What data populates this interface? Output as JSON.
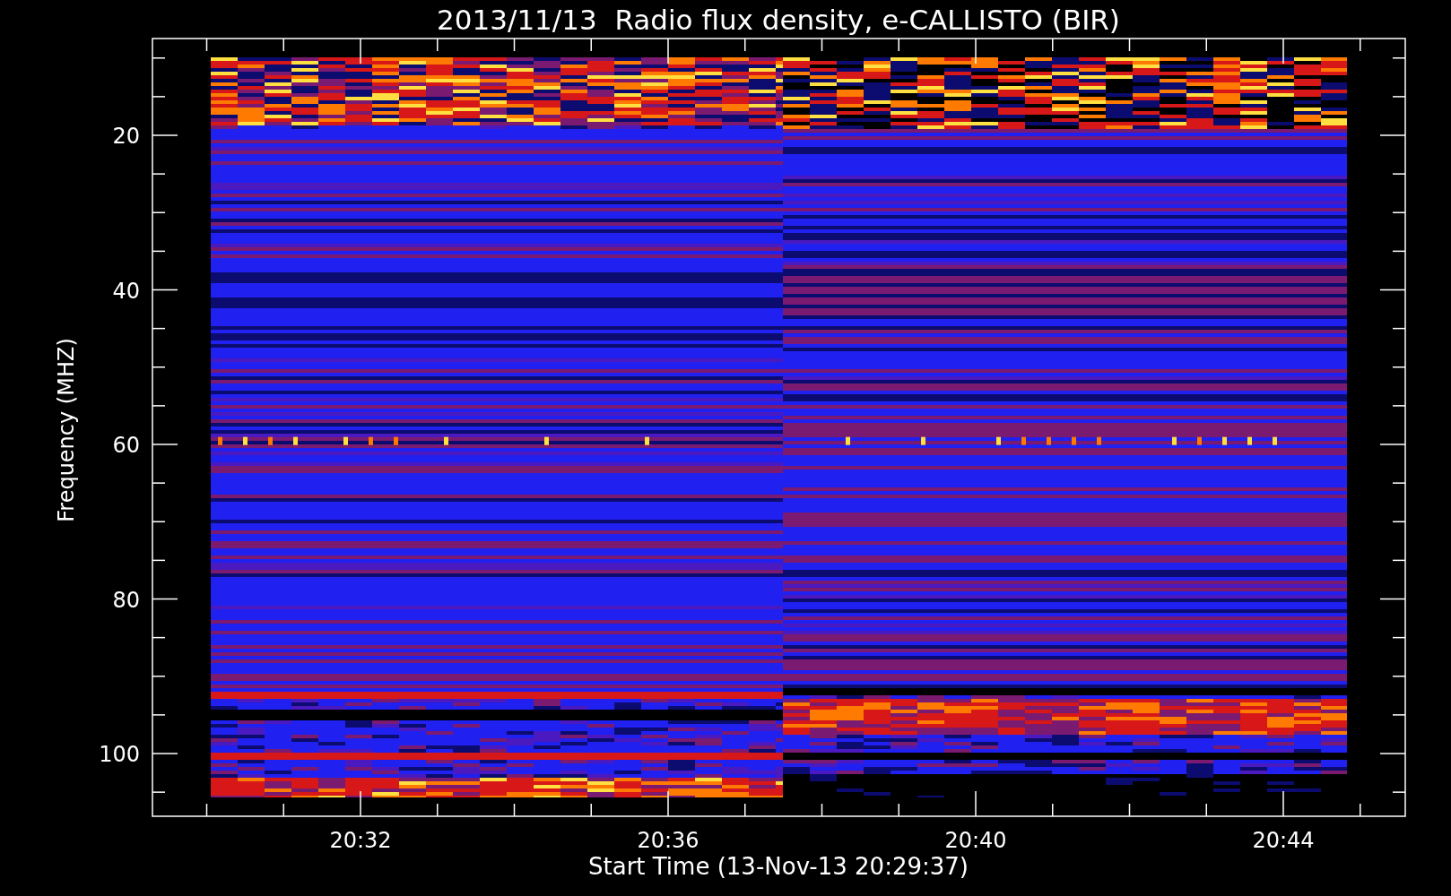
{
  "title": "2013/11/13  Radio flux density, e-CALLISTO (BIR)",
  "y_axis": {
    "label": "Frequency (MHZ)",
    "ticks": [
      "20",
      "40",
      "60",
      "80",
      "100"
    ]
  },
  "x_axis": {
    "label": "Start Time (13-Nov-13 20:29:37)",
    "ticks": [
      "20:32",
      "20:36",
      "20:40",
      "20:44"
    ]
  }
}
